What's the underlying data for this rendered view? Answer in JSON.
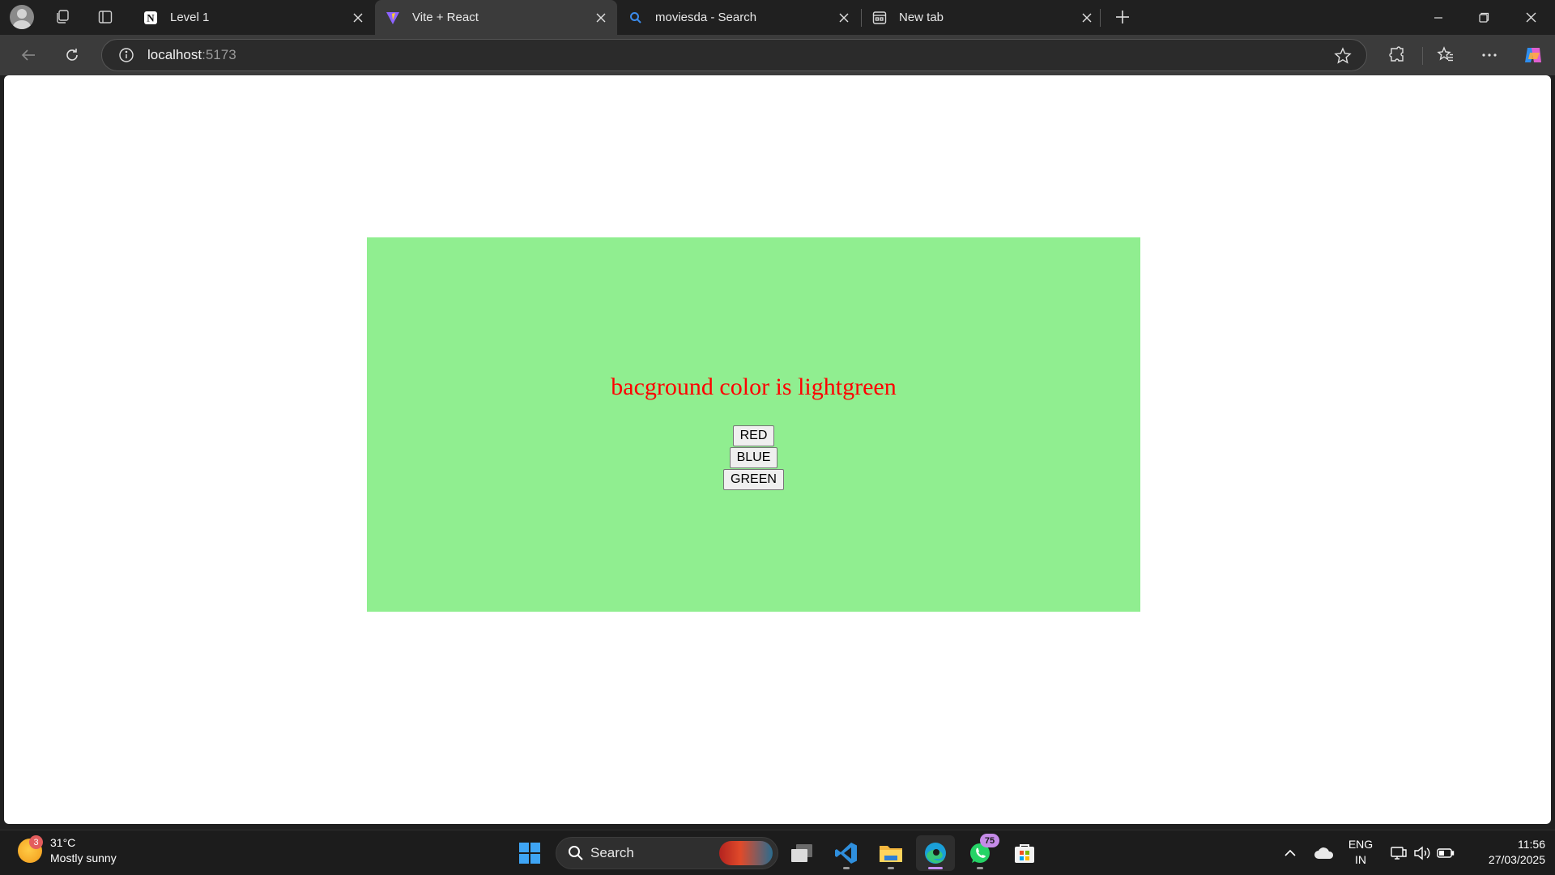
{
  "browser": {
    "tabs": [
      {
        "title": "Level 1",
        "icon": "notion-icon",
        "active": false
      },
      {
        "title": "Vite + React",
        "icon": "vite-icon",
        "active": true
      },
      {
        "title": "moviesda - Search",
        "icon": "search-icon",
        "active": false
      },
      {
        "title": "New tab",
        "icon": "new-tab-icon",
        "active": false
      }
    ],
    "address": {
      "host": "localhost",
      "port": ":5173"
    }
  },
  "page": {
    "heading": "bacground color is lightgreen",
    "background_color": "#90ee90",
    "heading_color": "#ff0000",
    "buttons": [
      "RED",
      "BLUE",
      "GREEN"
    ]
  },
  "taskbar": {
    "weather": {
      "temp": "31°C",
      "condition": "Mostly sunny",
      "badge": "3"
    },
    "search_label": "Search",
    "whatsapp_badge": "75",
    "language": {
      "line1": "ENG",
      "line2": "IN"
    },
    "clock": {
      "time": "11:56",
      "date": "27/03/2025"
    }
  }
}
